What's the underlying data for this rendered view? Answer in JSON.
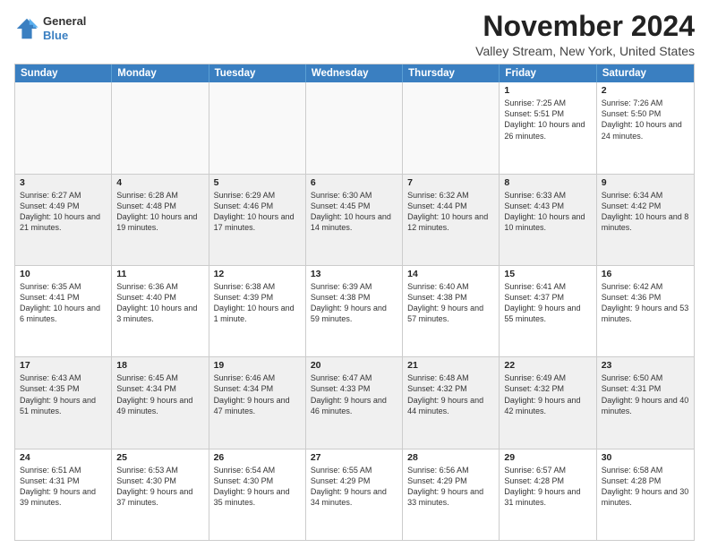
{
  "logo": {
    "general": "General",
    "blue": "Blue"
  },
  "title": "November 2024",
  "subtitle": "Valley Stream, New York, United States",
  "header_days": [
    "Sunday",
    "Monday",
    "Tuesday",
    "Wednesday",
    "Thursday",
    "Friday",
    "Saturday"
  ],
  "rows": [
    [
      {
        "day": "",
        "info": ""
      },
      {
        "day": "",
        "info": ""
      },
      {
        "day": "",
        "info": ""
      },
      {
        "day": "",
        "info": ""
      },
      {
        "day": "",
        "info": ""
      },
      {
        "day": "1",
        "info": "Sunrise: 7:25 AM\nSunset: 5:51 PM\nDaylight: 10 hours and 26 minutes."
      },
      {
        "day": "2",
        "info": "Sunrise: 7:26 AM\nSunset: 5:50 PM\nDaylight: 10 hours and 24 minutes."
      }
    ],
    [
      {
        "day": "3",
        "info": "Sunrise: 6:27 AM\nSunset: 4:49 PM\nDaylight: 10 hours and 21 minutes."
      },
      {
        "day": "4",
        "info": "Sunrise: 6:28 AM\nSunset: 4:48 PM\nDaylight: 10 hours and 19 minutes."
      },
      {
        "day": "5",
        "info": "Sunrise: 6:29 AM\nSunset: 4:46 PM\nDaylight: 10 hours and 17 minutes."
      },
      {
        "day": "6",
        "info": "Sunrise: 6:30 AM\nSunset: 4:45 PM\nDaylight: 10 hours and 14 minutes."
      },
      {
        "day": "7",
        "info": "Sunrise: 6:32 AM\nSunset: 4:44 PM\nDaylight: 10 hours and 12 minutes."
      },
      {
        "day": "8",
        "info": "Sunrise: 6:33 AM\nSunset: 4:43 PM\nDaylight: 10 hours and 10 minutes."
      },
      {
        "day": "9",
        "info": "Sunrise: 6:34 AM\nSunset: 4:42 PM\nDaylight: 10 hours and 8 minutes."
      }
    ],
    [
      {
        "day": "10",
        "info": "Sunrise: 6:35 AM\nSunset: 4:41 PM\nDaylight: 10 hours and 6 minutes."
      },
      {
        "day": "11",
        "info": "Sunrise: 6:36 AM\nSunset: 4:40 PM\nDaylight: 10 hours and 3 minutes."
      },
      {
        "day": "12",
        "info": "Sunrise: 6:38 AM\nSunset: 4:39 PM\nDaylight: 10 hours and 1 minute."
      },
      {
        "day": "13",
        "info": "Sunrise: 6:39 AM\nSunset: 4:38 PM\nDaylight: 9 hours and 59 minutes."
      },
      {
        "day": "14",
        "info": "Sunrise: 6:40 AM\nSunset: 4:38 PM\nDaylight: 9 hours and 57 minutes."
      },
      {
        "day": "15",
        "info": "Sunrise: 6:41 AM\nSunset: 4:37 PM\nDaylight: 9 hours and 55 minutes."
      },
      {
        "day": "16",
        "info": "Sunrise: 6:42 AM\nSunset: 4:36 PM\nDaylight: 9 hours and 53 minutes."
      }
    ],
    [
      {
        "day": "17",
        "info": "Sunrise: 6:43 AM\nSunset: 4:35 PM\nDaylight: 9 hours and 51 minutes."
      },
      {
        "day": "18",
        "info": "Sunrise: 6:45 AM\nSunset: 4:34 PM\nDaylight: 9 hours and 49 minutes."
      },
      {
        "day": "19",
        "info": "Sunrise: 6:46 AM\nSunset: 4:34 PM\nDaylight: 9 hours and 47 minutes."
      },
      {
        "day": "20",
        "info": "Sunrise: 6:47 AM\nSunset: 4:33 PM\nDaylight: 9 hours and 46 minutes."
      },
      {
        "day": "21",
        "info": "Sunrise: 6:48 AM\nSunset: 4:32 PM\nDaylight: 9 hours and 44 minutes."
      },
      {
        "day": "22",
        "info": "Sunrise: 6:49 AM\nSunset: 4:32 PM\nDaylight: 9 hours and 42 minutes."
      },
      {
        "day": "23",
        "info": "Sunrise: 6:50 AM\nSunset: 4:31 PM\nDaylight: 9 hours and 40 minutes."
      }
    ],
    [
      {
        "day": "24",
        "info": "Sunrise: 6:51 AM\nSunset: 4:31 PM\nDaylight: 9 hours and 39 minutes."
      },
      {
        "day": "25",
        "info": "Sunrise: 6:53 AM\nSunset: 4:30 PM\nDaylight: 9 hours and 37 minutes."
      },
      {
        "day": "26",
        "info": "Sunrise: 6:54 AM\nSunset: 4:30 PM\nDaylight: 9 hours and 35 minutes."
      },
      {
        "day": "27",
        "info": "Sunrise: 6:55 AM\nSunset: 4:29 PM\nDaylight: 9 hours and 34 minutes."
      },
      {
        "day": "28",
        "info": "Sunrise: 6:56 AM\nSunset: 4:29 PM\nDaylight: 9 hours and 33 minutes."
      },
      {
        "day": "29",
        "info": "Sunrise: 6:57 AM\nSunset: 4:28 PM\nDaylight: 9 hours and 31 minutes."
      },
      {
        "day": "30",
        "info": "Sunrise: 6:58 AM\nSunset: 4:28 PM\nDaylight: 9 hours and 30 minutes."
      }
    ]
  ]
}
